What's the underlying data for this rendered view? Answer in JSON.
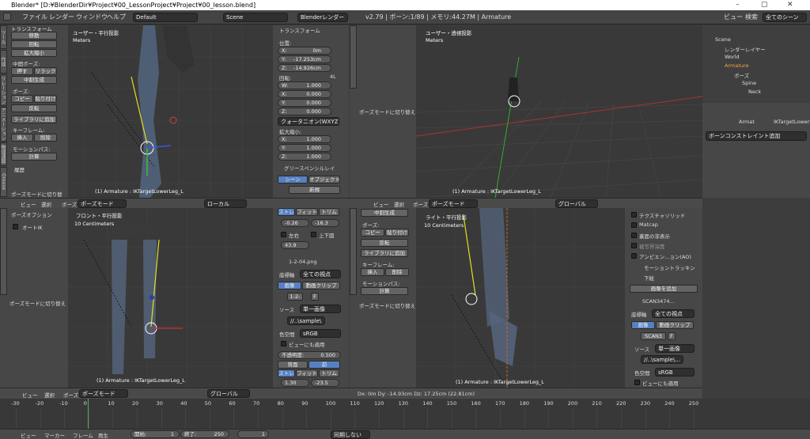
{
  "window": {
    "title": "Blender* [D:¥BlenderDir¥Project¥00_LessonProject¥Project¥00_lesson.blend]",
    "min": "–",
    "max": "▢",
    "close": "✕"
  },
  "menubar": {
    "items": [
      "ファイル",
      "レンダー",
      "ウィンドウ",
      "ヘルプ"
    ],
    "layout": "Default",
    "scene": "Scene",
    "engine": "Blenderレンダー",
    "version": "v2.79 | ボーン:1/89 | メモリ:44.27M | Armature",
    "view": "ビュー",
    "search": "検索",
    "all_scenes": "全てのシーン"
  },
  "toolshelf": {
    "transform": "トランスフォーム",
    "move": "移動",
    "rotate": "回転",
    "scale": "拡大縮小",
    "pose_mid": "中間ポーズ:",
    "push": "押す",
    "relax": "リラック",
    "breakdown": "中割生成",
    "pose": "ポーズ:",
    "copy": "コピー",
    "paste": "貼り付け",
    "flip": "反転",
    "lib_add": "ライブラリに追加",
    "keyframe": "キーフレーム:",
    "insert": "挿入",
    "delete": "削除",
    "motion": "モーションパス:",
    "calc": "計算",
    "history": "履歴",
    "switch_pose": "ポーズモードに切り替",
    "tabs": [
      "ツール",
      "作成",
      "リレーション",
      "アニメーション",
      "物理演算",
      "Grease Pencil"
    ]
  },
  "vp_tl": {
    "label": "ユーザー・平行投影",
    "units": "Meters",
    "status": "(1) Armature : IKTargetLowerLeg_L"
  },
  "npanel": {
    "transform": "トランスフォーム",
    "location": "位置:",
    "x": "X:",
    "x_val": "0m",
    "y": "Y:",
    "y_val": "-17.253cm",
    "z": "Z:",
    "z_val": "-14.926cm",
    "rotation": "回転:",
    "rot_mode": "4L",
    "w": "W:",
    "w_val": "1.000",
    "rx": "X:",
    "rx_val": "0.000",
    "ry": "Y:",
    "ry_val": "0.000",
    "rz": "Z:",
    "rz_val": "0.000",
    "quat": "クォータニオン(WXYZ)",
    "scale": "拡大縮小:",
    "sx": "X:",
    "sx_val": "1.000",
    "sy": "Y:",
    "sy_val": "1.000",
    "sz": "Z:",
    "sz_val": "1.000",
    "grease": "グリースペンシルレイ",
    "scene_btn": "シーン",
    "object_btn": "オブジェクト",
    "new_btn": "新規"
  },
  "vp_tr": {
    "label": "ユーザー・透視投影",
    "units": "Meters",
    "status": "(1) Armature : IKTargetLowerLeg_L",
    "switch_pose": "ポーズモードに切り替え"
  },
  "outliner": {
    "scene": "Scene",
    "render_layer": "レンダーレイヤー",
    "world": "World",
    "armature": "Armature",
    "pose": "ポーズ",
    "spine": "Spine",
    "neck": "Neck"
  },
  "props": {
    "breadcrumb1": "Armat",
    "breadcrumb2": "IKTargetLowerL",
    "add_constraint": "ボーンコンストレイント追加"
  },
  "hdr_mid": {
    "view": "ビュー",
    "select": "選択",
    "pose": "ポーズ",
    "mode": "ポーズモード",
    "orient": "ローカル",
    "view2": "ビュー",
    "select2": "選択",
    "pose2": "ポーズ",
    "mode2": "ポーズモード",
    "orient2": "グローバル"
  },
  "bl": {
    "pose_opt": "ポーズオプション",
    "auto_ik": "オートIK",
    "switch_pose": "ポーズモードに切り替え"
  },
  "vp_bl": {
    "label": "フロント・平行投影",
    "units": "10 Centimeters",
    "status": "(1) Armature : IKTargetLowerLeg_L"
  },
  "bgpanel": {
    "stretch": "ストレ",
    "fit": "フィット",
    "crop": "トリム",
    "ox": "-0.26",
    "oy": "-16.3",
    "flip_x": "左右",
    "flip_y": "上下図",
    "rot": "43.9",
    "img": "1-2-04.png",
    "axis": "座標軸",
    "all_views": "全ての視点",
    "image": "画像",
    "movie": "動画クリップ",
    "frame": "1-2-",
    "f": "F",
    "source": "ソース",
    "single": "単一画像",
    "path": "//..\\sample\\",
    "colorspace": "色空間",
    "srgb": "sRGB",
    "view_use": "ビューにも適用",
    "opacity": "不透明度:",
    "opacity_val": "0.500",
    "back": "背面",
    "front": "前",
    "stretch2": "ストレ",
    "fit2": "フィット",
    "crop2": "トリム",
    "zoom": "1.30",
    "zoom2": "-23.5"
  },
  "midshelf": {
    "breakdown": "中割生成",
    "pose": "ポーズ:",
    "copy": "コピー",
    "paste": "貼り付け",
    "flip": "反転",
    "lib_add": "ライブラリに追加",
    "keyframe": "キーフレーム:",
    "insert": "挿入",
    "delete": "削除",
    "motion": "モーションパス:",
    "calc": "計算",
    "switch_pose": "ポーズモードに切り替え"
  },
  "vp_br": {
    "label": "ライト・平行投影",
    "units": "10 Centimeters",
    "status": "(1) Armature : IKTargetLowerLeg_L",
    "dx": "Dx: 0m  Dy: -14.93cm  Dz: 17.25cm (22.81cm)"
  },
  "rpanel": {
    "texture_solid": "テクスチャソリッド",
    "matcap": "Matcap",
    "backface": "裏面の非表示",
    "depth": "被写界深度",
    "ao": "アンビエン...ョン(AO)",
    "motion_track": "モーショントラッキン",
    "background": "下絵",
    "add_image": "画像を追加",
    "scan": "SCAN3474...",
    "axis": "座標軸",
    "all_views": "全ての視点",
    "image": "画像",
    "movie": "動画クリップ",
    "scan2": "SCAN3",
    "f": "F",
    "source": "ソース",
    "single": "単一画像",
    "path": "//..\\sample\\...",
    "colorspace": "色空間",
    "srgb": "sRGB",
    "view_use": "ビューにも適用"
  },
  "timeline": {
    "ticks": [
      "-30",
      "-20",
      "-10",
      "0",
      "10",
      "20",
      "30",
      "40",
      "50",
      "60",
      "70",
      "80",
      "90",
      "100",
      "110",
      "120",
      "130",
      "140",
      "150",
      "160",
      "170",
      "180",
      "190",
      "200",
      "210",
      "220",
      "230",
      "240",
      "250"
    ],
    "view": "ビュー",
    "marker": "マーカー",
    "frame": "フレーム",
    "play": "再生",
    "start_lbl": "開始:",
    "start": "1",
    "end_lbl": "終了:",
    "end": "250",
    "current": "1",
    "sync": "同期しない"
  }
}
